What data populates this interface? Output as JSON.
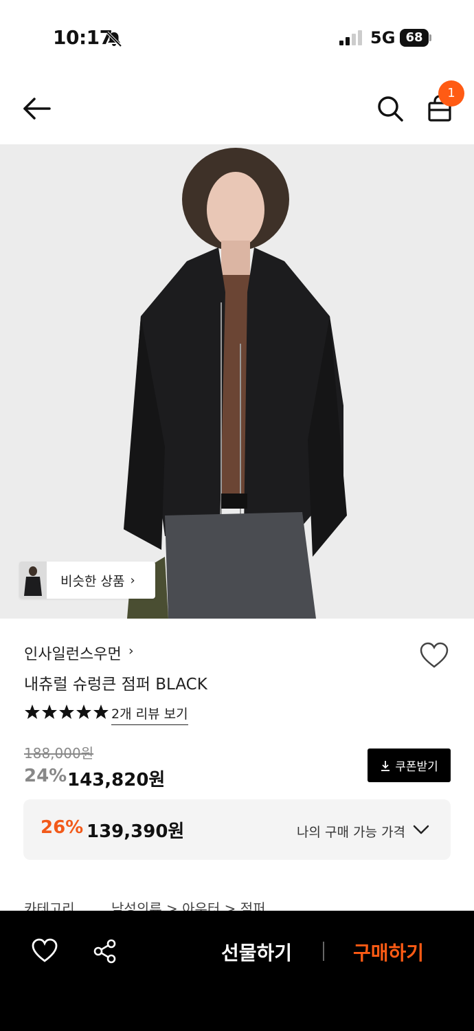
{
  "status_bar": {
    "time": "10:17",
    "network": "5G",
    "battery": "68",
    "icons": [
      "bell-slash-icon",
      "signal-icon",
      "battery-icon"
    ]
  },
  "header": {
    "cart_count": "1",
    "icons": [
      "back-arrow-icon",
      "search-icon",
      "shopping-bag-icon"
    ]
  },
  "image_overlay": {
    "similar_label": "비슷한 상품",
    "chevron": "›"
  },
  "product": {
    "brand": "인사일런스우먼",
    "brand_chevron": "›",
    "name": "내츄럴 슈렁큰 점퍼 BLACK",
    "rating_stars": 5,
    "review_link": "2개 리뷰 보기",
    "original_price": "188,000원",
    "discount_rate": "24%",
    "sale_price": "143,820원",
    "coupon_button": "쿠폰받기"
  },
  "best_price": {
    "rate": "26%",
    "price": "139,390원",
    "label": "나의 구매 가능 가격"
  },
  "category": {
    "label": "카테고리",
    "path": "남성의류 > 아우터 > 점퍼"
  },
  "bottom_bar": {
    "gift_label": "선물하기",
    "buy_label": "구매하기"
  },
  "colors": {
    "accent": "#ff5b14",
    "best_rate": "#f25a1a",
    "image_bg": "#ececec",
    "bottom_bar": "#000000"
  }
}
